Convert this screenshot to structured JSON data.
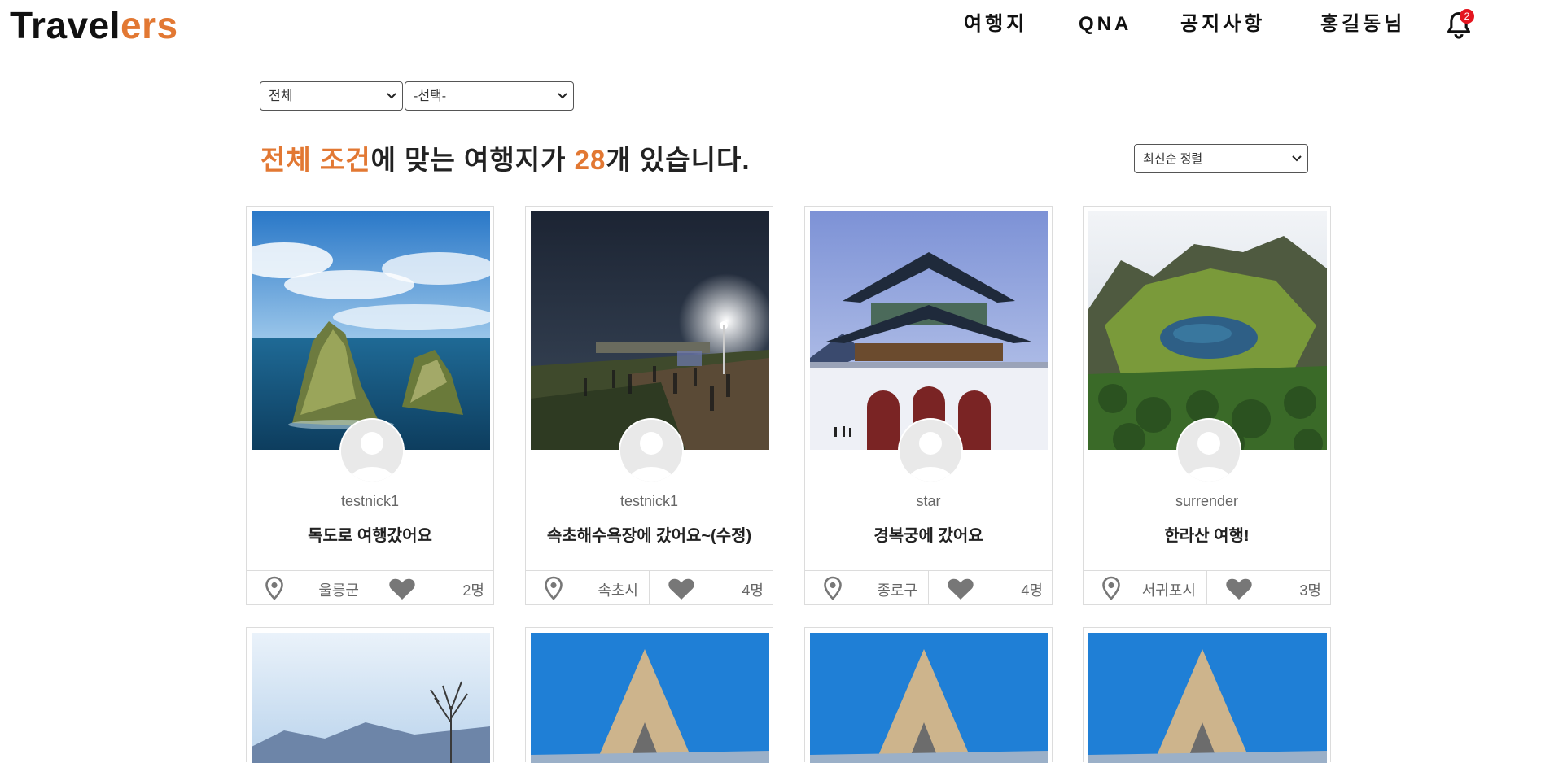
{
  "header": {
    "logo_main": "Travel",
    "logo_accent": "ers",
    "nav": [
      "여행지",
      "QNA",
      "공지사항",
      "홍길동님"
    ],
    "notification_count": "2"
  },
  "filters": {
    "region_selected": "전체",
    "city_selected": "-선택-",
    "sort_selected": "최신순 정렬"
  },
  "summary": {
    "highlight_condition": "전체 조건",
    "text_mid": "에 맞는 여행지가 ",
    "count": "28",
    "text_end": "개 있습니다."
  },
  "cards": [
    {
      "author": "testnick1",
      "title": "독도로 여행갔어요",
      "location": "울릉군",
      "likes": "2명"
    },
    {
      "author": "testnick1",
      "title": "속초해수욕장에 갔어요~(수정)",
      "location": "속초시",
      "likes": "4명"
    },
    {
      "author": "star",
      "title": "경복궁에 갔어요",
      "location": "종로구",
      "likes": "4명"
    },
    {
      "author": "surrender",
      "title": "한라산 여행!",
      "location": "서귀포시",
      "likes": "3명"
    },
    {
      "author": "",
      "title": "",
      "location": "",
      "likes": ""
    },
    {
      "author": "",
      "title": "",
      "location": "",
      "likes": ""
    },
    {
      "author": "",
      "title": "",
      "location": "",
      "likes": ""
    },
    {
      "author": "",
      "title": "",
      "location": "",
      "likes": ""
    }
  ],
  "colors": {
    "accent": "#e27833",
    "badge": "#e4151f",
    "icon_gray": "#777777"
  },
  "icons": [
    "bell-icon",
    "chevron-down-icon",
    "location-pin-icon",
    "heart-icon",
    "user-avatar-icon"
  ]
}
